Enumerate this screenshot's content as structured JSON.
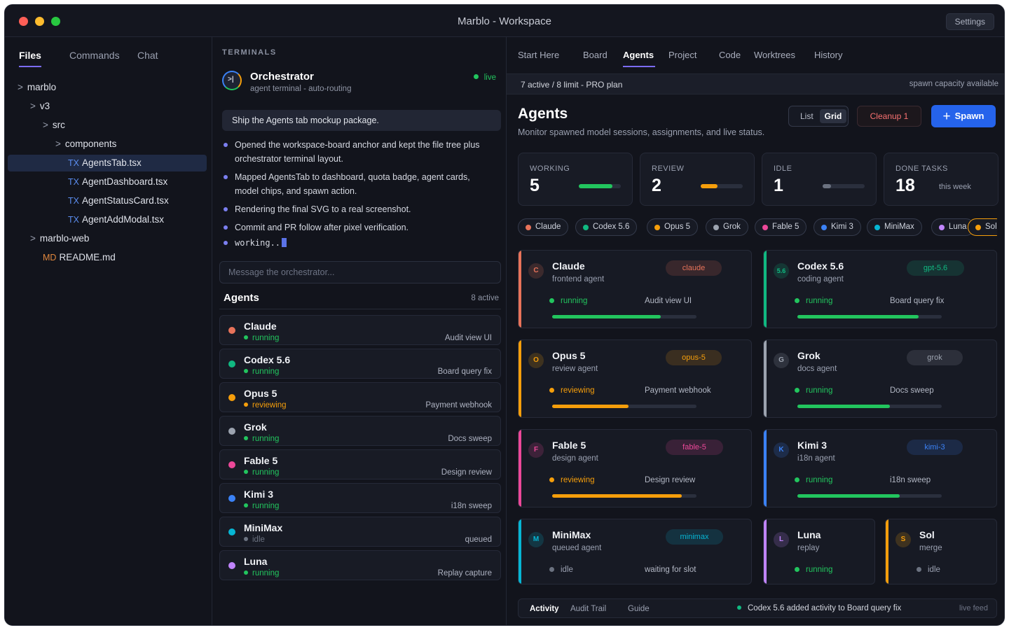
{
  "window": {
    "title": "Marblo - Workspace",
    "settings_label": "Settings"
  },
  "files": {
    "tabs": [
      "Files",
      "Commands",
      "Chat"
    ],
    "tree": [
      {
        "depth": 0,
        "type": "folder",
        "label": "marblo"
      },
      {
        "depth": 1,
        "type": "folder",
        "label": "v3"
      },
      {
        "depth": 2,
        "type": "folder",
        "label": "src"
      },
      {
        "depth": 3,
        "type": "folder",
        "label": "components"
      },
      {
        "depth": 4,
        "type": "file",
        "badge": "TX",
        "label": "AgentsTab.tsx",
        "selected": true
      },
      {
        "depth": 4,
        "type": "file",
        "badge": "TX",
        "label": "AgentDashboard.tsx"
      },
      {
        "depth": 4,
        "type": "file",
        "badge": "TX",
        "label": "AgentStatusCard.tsx"
      },
      {
        "depth": 4,
        "type": "file",
        "badge": "TX",
        "label": "AgentAddModal.tsx"
      },
      {
        "depth": 1,
        "type": "folder",
        "label": "marblo-web"
      },
      {
        "depth": 2,
        "type": "file",
        "badge": "MD",
        "label": "README.md"
      }
    ],
    "folder_glyph": ">"
  },
  "terminals": {
    "section_label": "TERMINALS",
    "orchestrator": {
      "title": "Orchestrator",
      "subtitle": "agent terminal - auto-routing",
      "status": "live",
      "icon_glyph": ">|"
    },
    "prompt": "Ship the Agents tab mockup package.",
    "log": [
      "Opened the workspace-board anchor and kept the file tree plus orchestrator terminal layout.",
      "Mapped AgentsTab to dashboard, quota badge, agent cards, model chips, and spawn action.",
      "Rendering the final SVG to a real screenshot.",
      "Commit and PR follow after pixel verification."
    ],
    "working": "working..",
    "message_placeholder": "Message the orchestrator...",
    "agents_heading": "Agents",
    "agents_count": "8 active",
    "agents": [
      {
        "name": "Claude",
        "status": "running",
        "task": "Audit view UI",
        "color": "#e8735a",
        "status_color": "#22c55e"
      },
      {
        "name": "Codex 5.6",
        "status": "running",
        "task": "Board query fix",
        "color": "#10b981",
        "status_color": "#22c55e"
      },
      {
        "name": "Opus 5",
        "status": "reviewing",
        "task": "Payment webhook",
        "color": "#f59e0b",
        "status_color": "#f59e0b"
      },
      {
        "name": "Grok",
        "status": "running",
        "task": "Docs sweep",
        "color": "#9ca3af",
        "status_color": "#22c55e"
      },
      {
        "name": "Fable 5",
        "status": "running",
        "task": "Design review",
        "color": "#ec4899",
        "status_color": "#22c55e"
      },
      {
        "name": "Kimi 3",
        "status": "running",
        "task": "i18n sweep",
        "color": "#3b82f6",
        "status_color": "#22c55e"
      },
      {
        "name": "MiniMax",
        "status": "idle",
        "task": "queued",
        "color": "#06b6d4",
        "status_color": "#6b7280"
      },
      {
        "name": "Luna",
        "status": "running",
        "task": "Replay capture",
        "color": "#c084fc",
        "status_color": "#22c55e"
      }
    ]
  },
  "right": {
    "tabs": [
      "Start Here",
      "Board",
      "Agents",
      "Project",
      "Code",
      "Worktrees",
      "History"
    ],
    "active_tab": "Agents",
    "plan": {
      "left": "7 active / 8 limit - PRO plan",
      "right": "spawn capacity available"
    },
    "title": "Agents",
    "subtitle": "Monitor spawned model sessions, assignments, and live status.",
    "view_toggle": {
      "list": "List",
      "grid": "Grid",
      "selected": "Grid"
    },
    "cleanup_label": "Cleanup 1",
    "spawn_label": "Spawn",
    "spawn_glyph": "+",
    "stats": [
      {
        "label": "WORKING",
        "value": "5",
        "progress": 0.8,
        "color": "#22c55e"
      },
      {
        "label": "REVIEW",
        "value": "2",
        "progress": 0.4,
        "color": "#f59e0b"
      },
      {
        "label": "IDLE",
        "value": "1",
        "progress": 0.2,
        "color": "#6b7280"
      },
      {
        "label": "DONE TASKS",
        "value": "18",
        "note": "this week"
      }
    ],
    "model_chips": [
      {
        "label": "Claude",
        "color": "#e8735a"
      },
      {
        "label": "Codex 5.6",
        "color": "#10b981"
      },
      {
        "label": "Opus 5",
        "color": "#f59e0b"
      },
      {
        "label": "Grok",
        "color": "#9ca3af"
      },
      {
        "label": "Fable 5",
        "color": "#ec4899"
      },
      {
        "label": "Kimi 3",
        "color": "#3b82f6"
      },
      {
        "label": "MiniMax",
        "color": "#06b6d4"
      },
      {
        "label": "Luna",
        "color": "#c084fc"
      },
      {
        "label": "Sol",
        "color": "#f59e0b"
      }
    ],
    "cards": [
      {
        "initial": "C",
        "name": "Claude",
        "role": "frontend agent",
        "model": "claude",
        "status": "running",
        "task": "Audit view UI",
        "progress": 0.75,
        "color": "#e8735a",
        "status_color": "#22c55e"
      },
      {
        "initial": "5.6",
        "name": "Codex 5.6",
        "role": "coding agent",
        "model": "gpt-5.6",
        "status": "running",
        "task": "Board query fix",
        "progress": 0.84,
        "color": "#10b981",
        "status_color": "#22c55e"
      },
      {
        "initial": "O",
        "name": "Opus 5",
        "role": "review agent",
        "model": "opus-5",
        "status": "reviewing",
        "task": "Payment webhook",
        "progress": 0.53,
        "color": "#f59e0b",
        "status_color": "#f59e0b"
      },
      {
        "initial": "G",
        "name": "Grok",
        "role": "docs agent",
        "model": "grok",
        "status": "running",
        "task": "Docs sweep",
        "progress": 0.64,
        "color": "#9ca3af",
        "status_color": "#22c55e"
      },
      {
        "initial": "F",
        "name": "Fable 5",
        "role": "design agent",
        "model": "fable-5",
        "status": "reviewing",
        "task": "Design review",
        "progress": 0.9,
        "color": "#ec4899",
        "status_color": "#f59e0b"
      },
      {
        "initial": "K",
        "name": "Kimi 3",
        "role": "i18n agent",
        "model": "kimi-3",
        "status": "running",
        "task": "i18n sweep",
        "progress": 0.71,
        "color": "#3b82f6",
        "status_color": "#22c55e"
      },
      {
        "initial": "M",
        "name": "MiniMax",
        "role": "queued agent",
        "model": "minimax",
        "status": "idle",
        "task": "waiting for slot",
        "color": "#06b6d4",
        "status_color": "#6b7280"
      },
      {
        "initial": "L",
        "name": "Luna",
        "role": "replay",
        "status": "running",
        "color": "#c084fc",
        "status_color": "#22c55e"
      },
      {
        "initial": "S",
        "name": "Sol",
        "role": "merge",
        "status": "idle",
        "color": "#f59e0b",
        "status_color": "#6b7280"
      }
    ],
    "activity": {
      "tabs": [
        "Activity",
        "Audit Trail",
        "Guide"
      ],
      "message": "Codex 5.6 added activity to Board query fix",
      "live_label": "live feed"
    }
  }
}
